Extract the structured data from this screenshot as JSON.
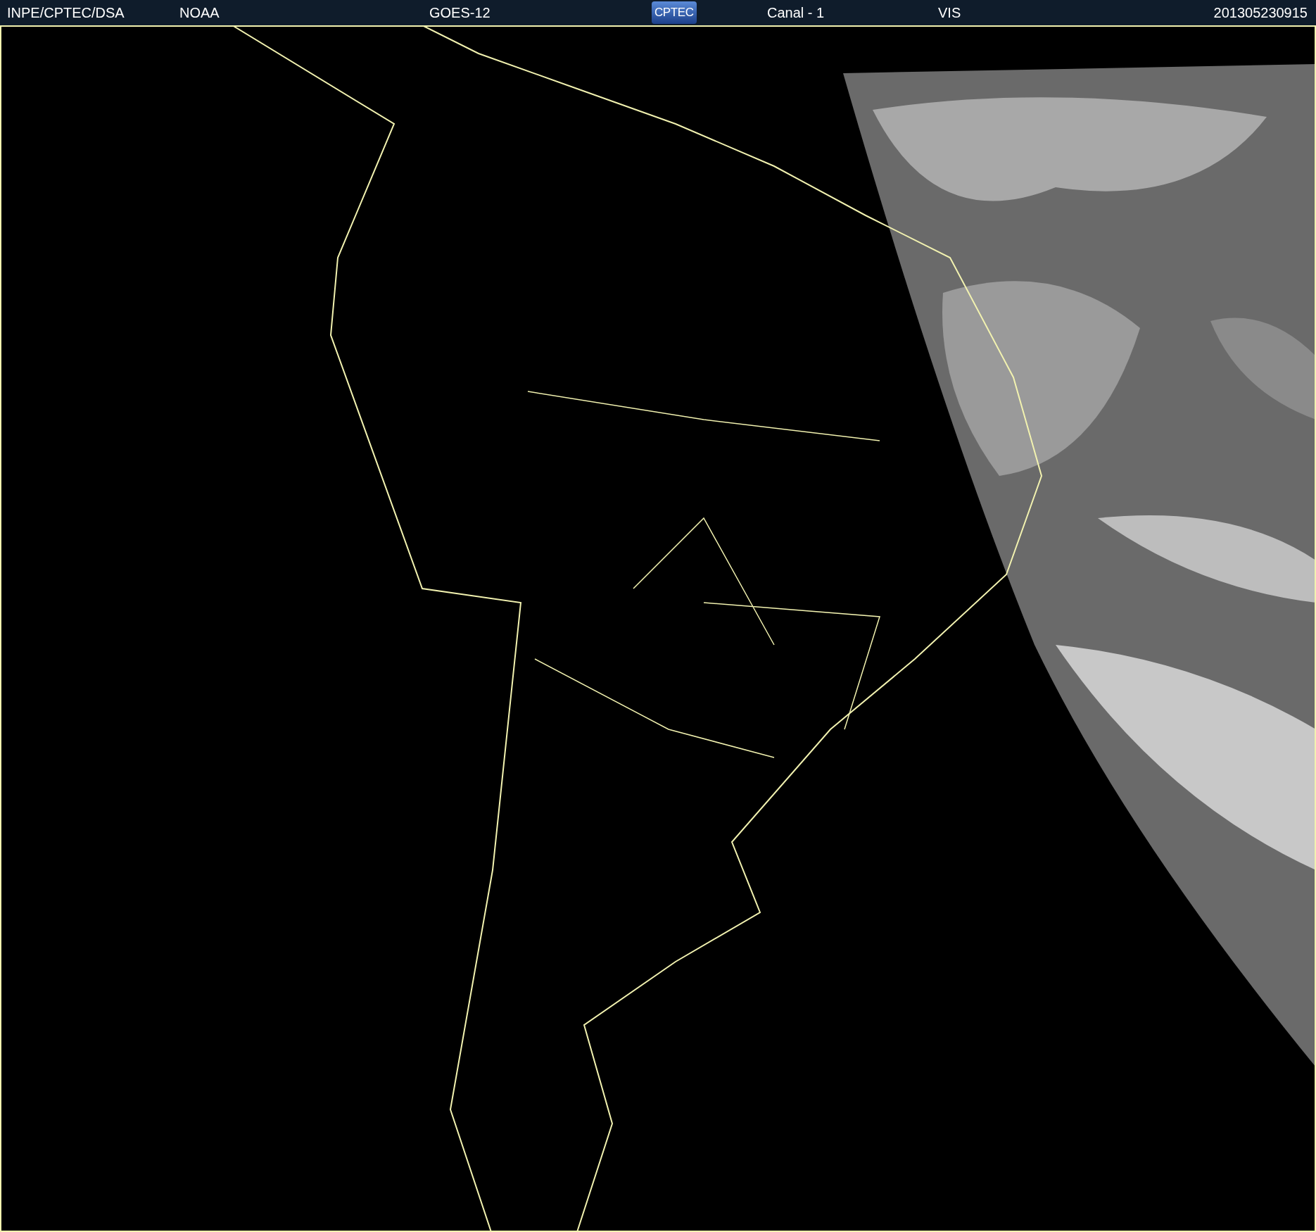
{
  "header": {
    "items": [
      {
        "kind": "text",
        "text": "INPE/CPTEC/DSA"
      },
      {
        "kind": "text",
        "text": "NOAA"
      },
      {
        "kind": "text",
        "text": "GOES-12"
      },
      {
        "kind": "logo",
        "text": "CPTEC"
      },
      {
        "kind": "text",
        "text": "Canal - 1"
      },
      {
        "kind": "text",
        "text": "VIS"
      },
      {
        "kind": "text",
        "text": "201305230915"
      }
    ]
  }
}
